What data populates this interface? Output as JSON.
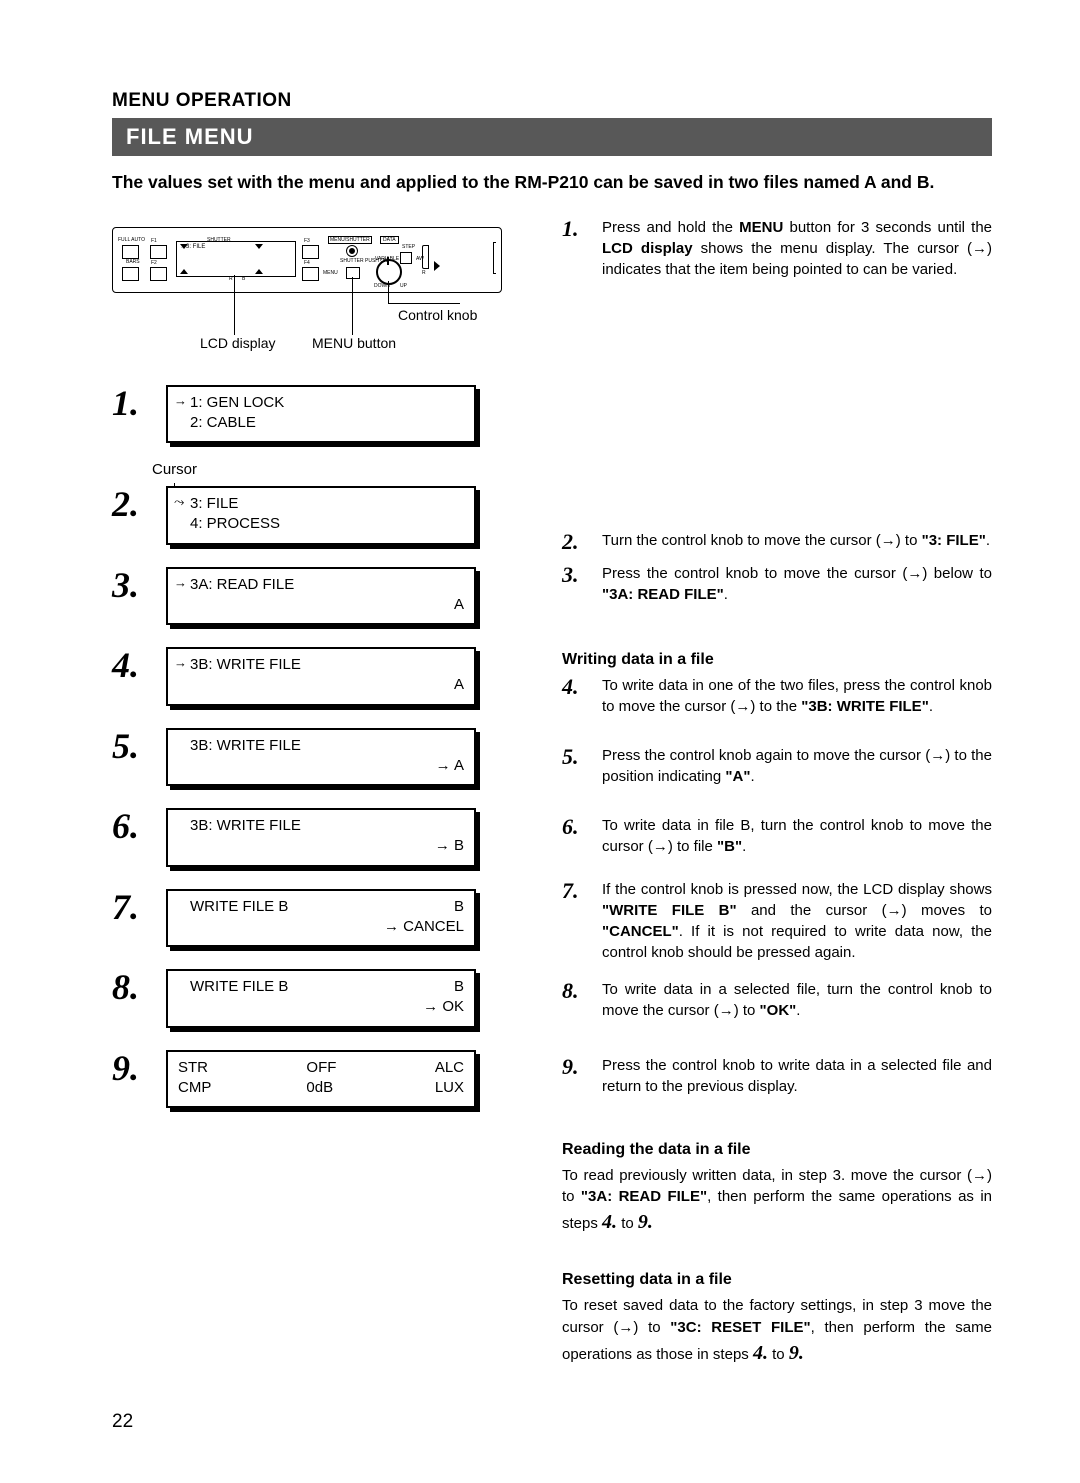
{
  "chapter": "MENU OPERATION",
  "section": "FILE MENU",
  "intro": "The values set with the menu and applied to the RM-P210 can be saved in two files named A and B.",
  "device": {
    "lcd_line1": "→3: FILE",
    "full_auto": "FULL AUTO",
    "bars": "BARS",
    "f1": "F1",
    "f2": "F2",
    "f3": "F3",
    "f4": "F4",
    "shutter": "SHUTTER",
    "menu": "MENU",
    "menushutter": "MENU/SHUTTER",
    "data": "DATA",
    "step": "STEP",
    "variable": "VARIABLE",
    "shutter_push_on": "SHUTTER PUSH ON",
    "down": "DOWN",
    "up": "UP",
    "r": "R",
    "b": "B",
    "aw": "AW"
  },
  "labels": {
    "control_knob": "Control knob",
    "lcd_display": "LCD display",
    "menu_button": "MENU button",
    "cursor": "Cursor"
  },
  "boxes": {
    "b1": {
      "l1": "1: GEN LOCK",
      "l2": "2: CABLE"
    },
    "b2": {
      "l1": "3: FILE",
      "l2": "4: PROCESS"
    },
    "b3": {
      "l1": "3A: READ FILE",
      "r": "A"
    },
    "b4": {
      "l1": "3B: WRITE FILE",
      "r": "A"
    },
    "b5": {
      "l1": "3B: WRITE FILE",
      "r": "→   A"
    },
    "b6": {
      "l1": "3B: WRITE FILE",
      "r": "→   B"
    },
    "b7": {
      "l1": "WRITE FILE B",
      "r1": "B",
      "r2": "→   CANCEL"
    },
    "b8": {
      "l1": "WRITE FILE B",
      "r1": "B",
      "r2": "→   OK"
    },
    "b9": {
      "c1": "STR",
      "c2": "OFF",
      "c3": "ALC",
      "d1": "CMP",
      "d2": "0dB",
      "d3": "LUX"
    }
  },
  "right": {
    "s1a": "Press and hold the ",
    "s1b": "MENU",
    "s1c": " button for 3 seconds until the ",
    "s1d": "LCD display",
    "s1e": " shows the menu display. The cursor (→) indicates that the item being pointed to can be varied.",
    "s2a": "Turn the control knob to move the cursor (→) to ",
    "s2b": "\"3: FILE\"",
    "s2c": ".",
    "s3a": "Press the control knob to move the cursor (→) below to ",
    "s3b": "\"3A: READ FILE\"",
    "s3c": ".",
    "writing_head": "Writing data in a file",
    "s4a": "To write data in one of the two files, press the control knob to move the cursor (→) to the ",
    "s4b": "\"3B: WRITE FILE\"",
    "s4c": ".",
    "s5a": "Press the control knob again to move the cursor (→) to the position indicating ",
    "s5b": "\"A\"",
    "s5c": ".",
    "s6a": "To write data in file B, turn the control knob to move the cursor (→) to file ",
    "s6b": "\"B\"",
    "s6c": ".",
    "s7a": "If the control knob is pressed now, the LCD display shows ",
    "s7b": "\"WRITE FILE B\"",
    "s7c": " and the cursor (→) moves to ",
    "s7d": "\"CANCEL\"",
    "s7e": ". If it is not required to write data now, the control knob should be pressed again.",
    "s8a": "To write data in a selected file, turn the control knob to move the cursor (→) to ",
    "s8b": "\"OK\"",
    "s8c": ".",
    "s9": "Press the control knob to write data in a selected file and return to the previous display.",
    "reading_head": "Reading the data in a file",
    "reading_a": "To read previously written data, in step 3. move the cursor (→) to ",
    "reading_b": "\"3A: READ FILE\"",
    "reading_c": ", then perform the same operations as in steps ",
    "reading_d": "4.",
    "reading_e": " to ",
    "reading_f": "9.",
    "resetting_head": "Resetting data in a file",
    "reset_a": "To reset saved data to the factory settings, in step 3 move the cursor (→) to ",
    "reset_b": "\"3C: RESET FILE\"",
    "reset_c": ", then perform the same operations as those in steps ",
    "reset_d": "4.",
    "reset_e": " to ",
    "reset_f": "9."
  },
  "page_number": "22"
}
